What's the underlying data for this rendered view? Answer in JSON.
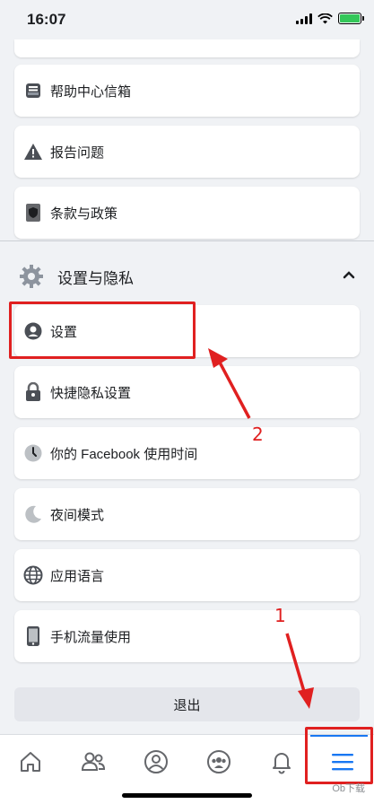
{
  "status_bar": {
    "time": "16:07"
  },
  "menu_items_top": [
    {
      "label": "帮助中心信箱",
      "icon": "inbox-icon"
    },
    {
      "label": "报告问题",
      "icon": "warning-icon"
    },
    {
      "label": "条款与政策",
      "icon": "book-shield-icon"
    }
  ],
  "section": {
    "title": "设置与隐私",
    "icon": "gear-icon",
    "expanded": true
  },
  "menu_items_settings": [
    {
      "label": "设置",
      "icon": "profile-icon"
    },
    {
      "label": "快捷隐私设置",
      "icon": "lock-icon"
    },
    {
      "label": "你的 Facebook 使用时间",
      "icon": "clock-icon"
    },
    {
      "label": "夜间模式",
      "icon": "moon-icon"
    },
    {
      "label": "应用语言",
      "icon": "globe-icon"
    },
    {
      "label": "手机流量使用",
      "icon": "phone-icon"
    }
  ],
  "logout_label": "退出",
  "tabs": [
    {
      "name": "home",
      "icon": "home-icon"
    },
    {
      "name": "friends",
      "icon": "friends-icon"
    },
    {
      "name": "profile",
      "icon": "profile-circle-icon"
    },
    {
      "name": "groups",
      "icon": "groups-icon"
    },
    {
      "name": "notifications",
      "icon": "bell-icon"
    },
    {
      "name": "menu",
      "icon": "menu-icon",
      "active": true
    }
  ],
  "annotations": {
    "step1": "1",
    "step2": "2"
  },
  "watermark": "Ob下载",
  "colors": {
    "accent": "#1877f2",
    "annotation": "#e02020",
    "background": "#f0f2f5"
  }
}
